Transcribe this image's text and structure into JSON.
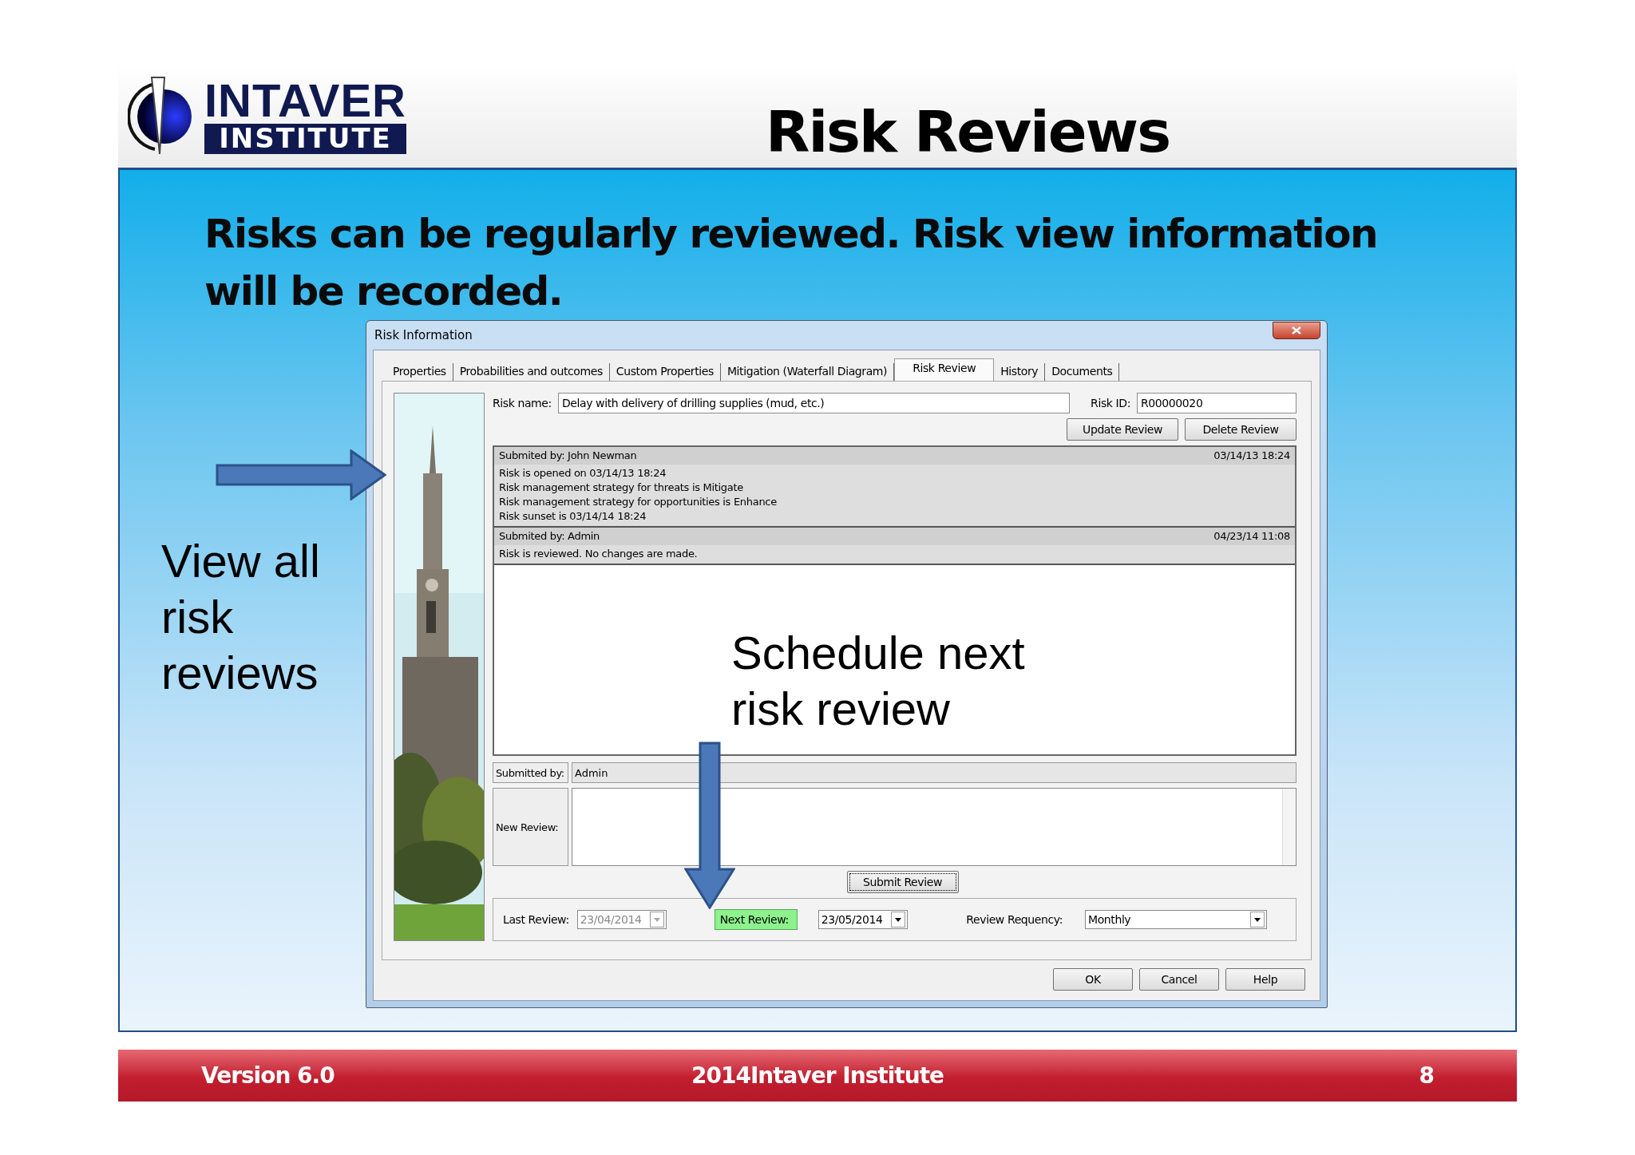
{
  "header": {
    "logo_top": "INTAVER",
    "logo_bottom": "INSTITUTE",
    "title": "Risk Reviews"
  },
  "intro": "Risks can be regularly reviewed. Risk view information will be recorded.",
  "callouts": [
    {
      "kind": "left",
      "text": "View all risk reviews"
    },
    {
      "kind": "right",
      "text": "Schedule next risk review"
    }
  ],
  "dialog": {
    "title": "Risk Information",
    "tabs": [
      {
        "label": "Properties",
        "selected": false
      },
      {
        "label": "Probabilities and outcomes",
        "selected": false
      },
      {
        "label": "Custom Properties",
        "selected": false
      },
      {
        "label": "Mitigation (Waterfall Diagram)",
        "selected": false
      },
      {
        "label": "Risk Review",
        "selected": true
      },
      {
        "label": "History",
        "selected": false
      },
      {
        "label": "Documents",
        "selected": false
      }
    ],
    "risk_name_label": "Risk name:",
    "risk_name": "Delay with delivery of drilling supplies (mud, etc.)",
    "risk_id_label": "Risk ID:",
    "risk_id": "R00000020",
    "review_buttons": [
      "Update Review",
      "Delete Review"
    ],
    "reviews": [
      {
        "submitted_by": "Submited by: John Newman",
        "date": "03/14/13 18:24",
        "lines": [
          "Risk is opened on 03/14/13 18:24",
          "Risk management strategy for threats is Mitigate",
          "Risk management strategy for opportunities is Enhance",
          "Risk sunset is 03/14/14 18:24"
        ]
      },
      {
        "submitted_by": "Submited by: Admin",
        "date": "04/23/14 11:08",
        "lines": [
          "Risk is reviewed. No changes are made."
        ]
      }
    ],
    "submitted_by_label": "Submitted by:",
    "submitted_by": "Admin",
    "new_review_label": "New Review:",
    "submit_button": "Submit Review",
    "last_review": {
      "label": "Last Review:",
      "value": "23/04/2014",
      "disabled": true
    },
    "next_review": {
      "label": "Next Review:",
      "value": "23/05/2014"
    },
    "frequency": {
      "label": "Review Requency:",
      "value": "Monthly"
    },
    "buttons": [
      "OK",
      "Cancel",
      "Help"
    ]
  },
  "footer": {
    "version": "Version 6.0",
    "center": "2014Intaver Institute",
    "page": "8"
  }
}
